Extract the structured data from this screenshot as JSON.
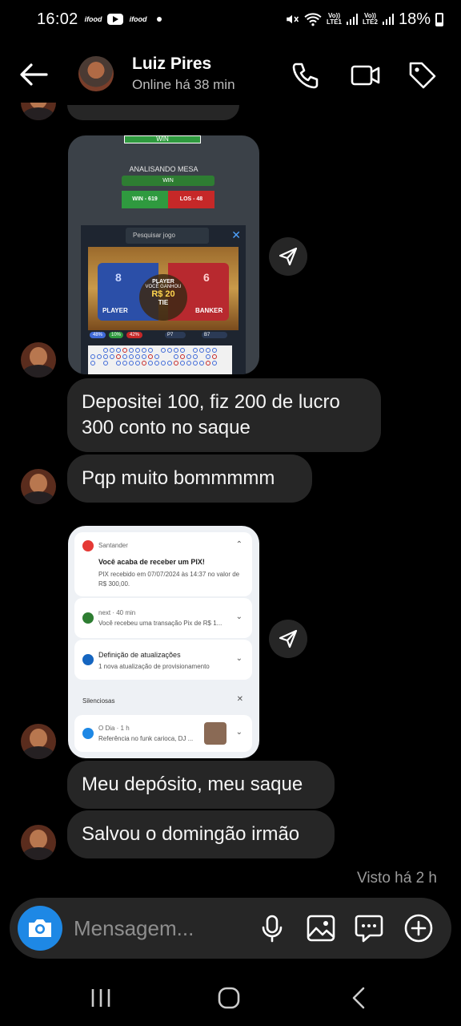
{
  "status_bar": {
    "time": "16:02",
    "app1": "ifood",
    "app2": "ifood",
    "sim1": "Vo))\nLTE1",
    "sim2": "Vo))\nLTE2",
    "battery": "18%"
  },
  "header": {
    "contact_name": "Luiz Pires",
    "presence": "Online há 38 min"
  },
  "messages": {
    "game": {
      "top_label": "WIN",
      "title": "ANALISANDO MESA",
      "result_bar": "WIN",
      "win_count": "WIN - 619",
      "loss_count": "LOS - 48",
      "search_placeholder": "Pesquisar jogo",
      "player_label": "PLAYER",
      "banker_label": "BANKER",
      "player_score": "8",
      "banker_score": "6",
      "center_player": "PLAYER",
      "you_won": "VOCÊ GANHOU",
      "amount": "R$ 20",
      "tie_label": "TIE",
      "stats_p": "48%",
      "stats_t": "10%",
      "stats_b": "42%",
      "stats_p7": "P7",
      "stats_b7": "B7"
    },
    "text1": "Depositei 100, fiz 200 de lucro 300 conto no saque",
    "text2": "Pqp muito bommmmm",
    "notif": {
      "bank_app": "Santander",
      "bank_title": "Você acaba de receber um PIX!",
      "bank_text": "PIX recebido em 07/07/2024 às 14:37 no valor de R$ 300,00.",
      "next_app": "next · 40 min",
      "next_text": "Você recebeu uma transação Pix de R$ 1...",
      "update_title": "Definição de atualizações",
      "update_text": "1 nova atualização de provisionamento",
      "silent_label": "Silenciosas",
      "odia_app": "O Dia · 1 h",
      "odia_text": "Referência no funk carioca, DJ ..."
    },
    "text3": "Meu depósito, meu saque",
    "text4": "Salvou o domingão irmão",
    "seen": "Visto há 2 h"
  },
  "composer": {
    "placeholder": "Mensagem..."
  },
  "icons": {
    "back": "arrow-left-icon",
    "call": "phone-icon",
    "video": "video-icon",
    "tag": "tag-icon",
    "share": "send-icon",
    "camera": "camera-icon",
    "mic": "microphone-icon",
    "gallery": "image-icon",
    "sticker": "chat-bubble-icon",
    "plus": "plus-icon"
  },
  "colors": {
    "background": "#000000",
    "bubble": "#262626",
    "camera_button": "#1e88e5",
    "secondary_text": "#9a9a9a"
  }
}
